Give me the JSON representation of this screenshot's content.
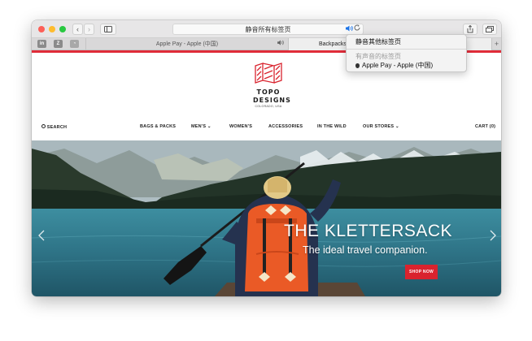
{
  "toolbar": {
    "back": "‹",
    "forward": "›",
    "sidebar_icon": "sidebar-icon",
    "address_text": "静音所有标签页",
    "speaker_icon": "speaker-icon",
    "reload_icon": "reload-icon",
    "share_icon": "share-icon",
    "tabs_icon": "tabs-overview-icon"
  },
  "tabs": {
    "pinned": [
      {
        "label": "in",
        "icon": "linkedin-icon",
        "color": "#7a7a7a"
      },
      {
        "label": "Z",
        "icon": "z-icon",
        "color": "#7a7a7a"
      },
      {
        "label": "◔",
        "icon": "site-icon",
        "color": "#7a7a7a"
      }
    ],
    "items": [
      {
        "title": "Apple Pay - Apple (中国)"
      },
      {
        "title": "Backpacks"
      }
    ],
    "new_tab": "+"
  },
  "site": {
    "logo": {
      "line1": "TOPO",
      "line2": "DESIGNS",
      "sub": "COLORADO, USA"
    },
    "nav": {
      "search": "SEARCH",
      "items": [
        "BAGS & PACKS",
        "MEN'S",
        "WOMEN'S",
        "ACCESSORIES",
        "IN THE WILD",
        "OUR STORES"
      ],
      "cart": "CART (0)"
    },
    "hero": {
      "title": "THE KLETTERSACK",
      "subtitle": "The ideal travel companion.",
      "button": "SHOP NOW"
    }
  },
  "dropdown": {
    "item_mute_others": "静音其他标签页",
    "header_playing": "有声音的标签页",
    "tab_entry": "Apple Pay - Apple (中国)"
  },
  "colors": {
    "accent_red": "#e02c39",
    "button_red": "#d9232e"
  }
}
